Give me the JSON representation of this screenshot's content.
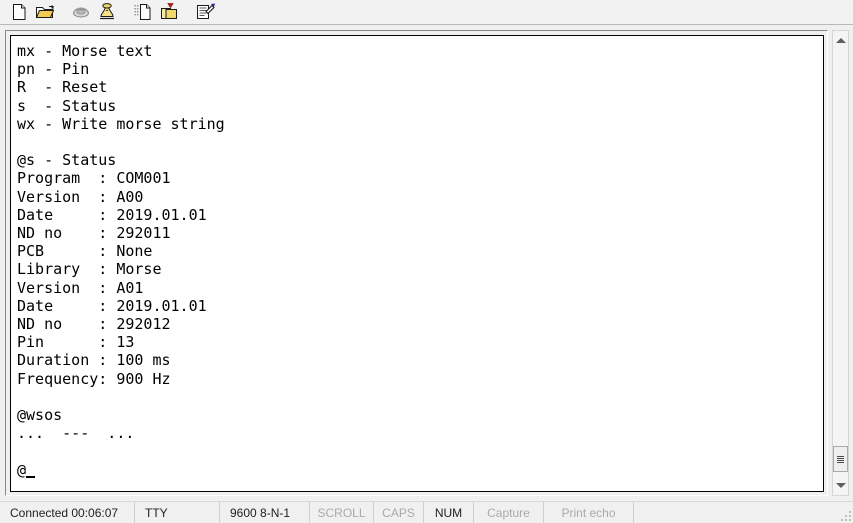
{
  "toolbar": {
    "buttons": [
      {
        "name": "new-file-icon",
        "title": "New"
      },
      {
        "name": "open-folder-icon",
        "title": "Open"
      },
      {
        "name": "telephone-icon",
        "title": "Disconnect"
      },
      {
        "name": "dial-phone-icon",
        "title": "Dial"
      },
      {
        "name": "copy-icon",
        "title": "Copy"
      },
      {
        "name": "paste-icon",
        "title": "Paste"
      },
      {
        "name": "properties-icon",
        "title": "Properties"
      }
    ]
  },
  "terminal": {
    "lines": [
      "mx - Morse text",
      "pn - Pin",
      "R  - Reset",
      "s  - Status",
      "wx - Write morse string",
      "",
      "@s - Status",
      "Program   : COM001",
      "Version   : A00",
      "Date      : 2019.01.01",
      "ND no     : 292011",
      "PCB       : None",
      "Library   : Morse",
      "Version   : A01",
      "Date      : 2019.01.01",
      "ND no     : 292012",
      "Pin       : 13",
      "Duration  : 100 ms",
      "Frequency : 900 Hz",
      "",
      "@wsos",
      "...  ---  ...",
      "",
      "@"
    ],
    "text": "mx - Morse text\npn - Pin\nR  - Reset\ns  - Status\nwx - Write morse string\n\n@s - Status\nProgram  : COM001\nVersion  : A00\nDate     : 2019.01.01\nND no    : 292011\nPCB      : None\nLibrary  : Morse\nVersion  : A01\nDate     : 2019.01.01\nND no    : 292012\nPin      : 13\nDuration : 100 ms\nFrequency: 900 Hz\n\n@wsos\n...  ---  ...\n\n@",
    "commands": [
      {
        "key": "mx",
        "desc": "Morse text"
      },
      {
        "key": "pn",
        "desc": "Pin"
      },
      {
        "key": "R",
        "desc": "Reset"
      },
      {
        "key": "s",
        "desc": "Status"
      },
      {
        "key": "wx",
        "desc": "Write morse string"
      }
    ],
    "status_block": {
      "header": "@s - Status",
      "fields": [
        {
          "label": "Program",
          "value": "COM001"
        },
        {
          "label": "Version",
          "value": "A00"
        },
        {
          "label": "Date",
          "value": "2019.01.01"
        },
        {
          "label": "ND no",
          "value": "292011"
        },
        {
          "label": "PCB",
          "value": "None"
        },
        {
          "label": "Library",
          "value": "Morse"
        },
        {
          "label": "Version",
          "value": "A01"
        },
        {
          "label": "Date",
          "value": "2019.01.01"
        },
        {
          "label": "ND no",
          "value": "292012"
        },
        {
          "label": "Pin",
          "value": "13"
        },
        {
          "label": "Duration",
          "value": "100 ms"
        },
        {
          "label": "Frequency",
          "value": "900 Hz"
        }
      ]
    },
    "morse_command": "@wsos",
    "morse_output": "...  ---  ...",
    "prompt": "@",
    "text_color": "#000000",
    "background_color": "#ffffff"
  },
  "scrollbar": {
    "up_arrow": "scroll-up-arrow",
    "down_arrow": "scroll-down-arrow",
    "thumb": "scroll-thumb"
  },
  "statusbar": {
    "connected": "Connected 00:06:07",
    "tty": "TTY",
    "baud": "9600 8-N-1",
    "scroll": "SCROLL",
    "caps": "CAPS",
    "num": "NUM",
    "capture": "Capture",
    "print_echo": "Print echo",
    "active_color": "#222222",
    "inactive_color": "#aaaaaa"
  }
}
